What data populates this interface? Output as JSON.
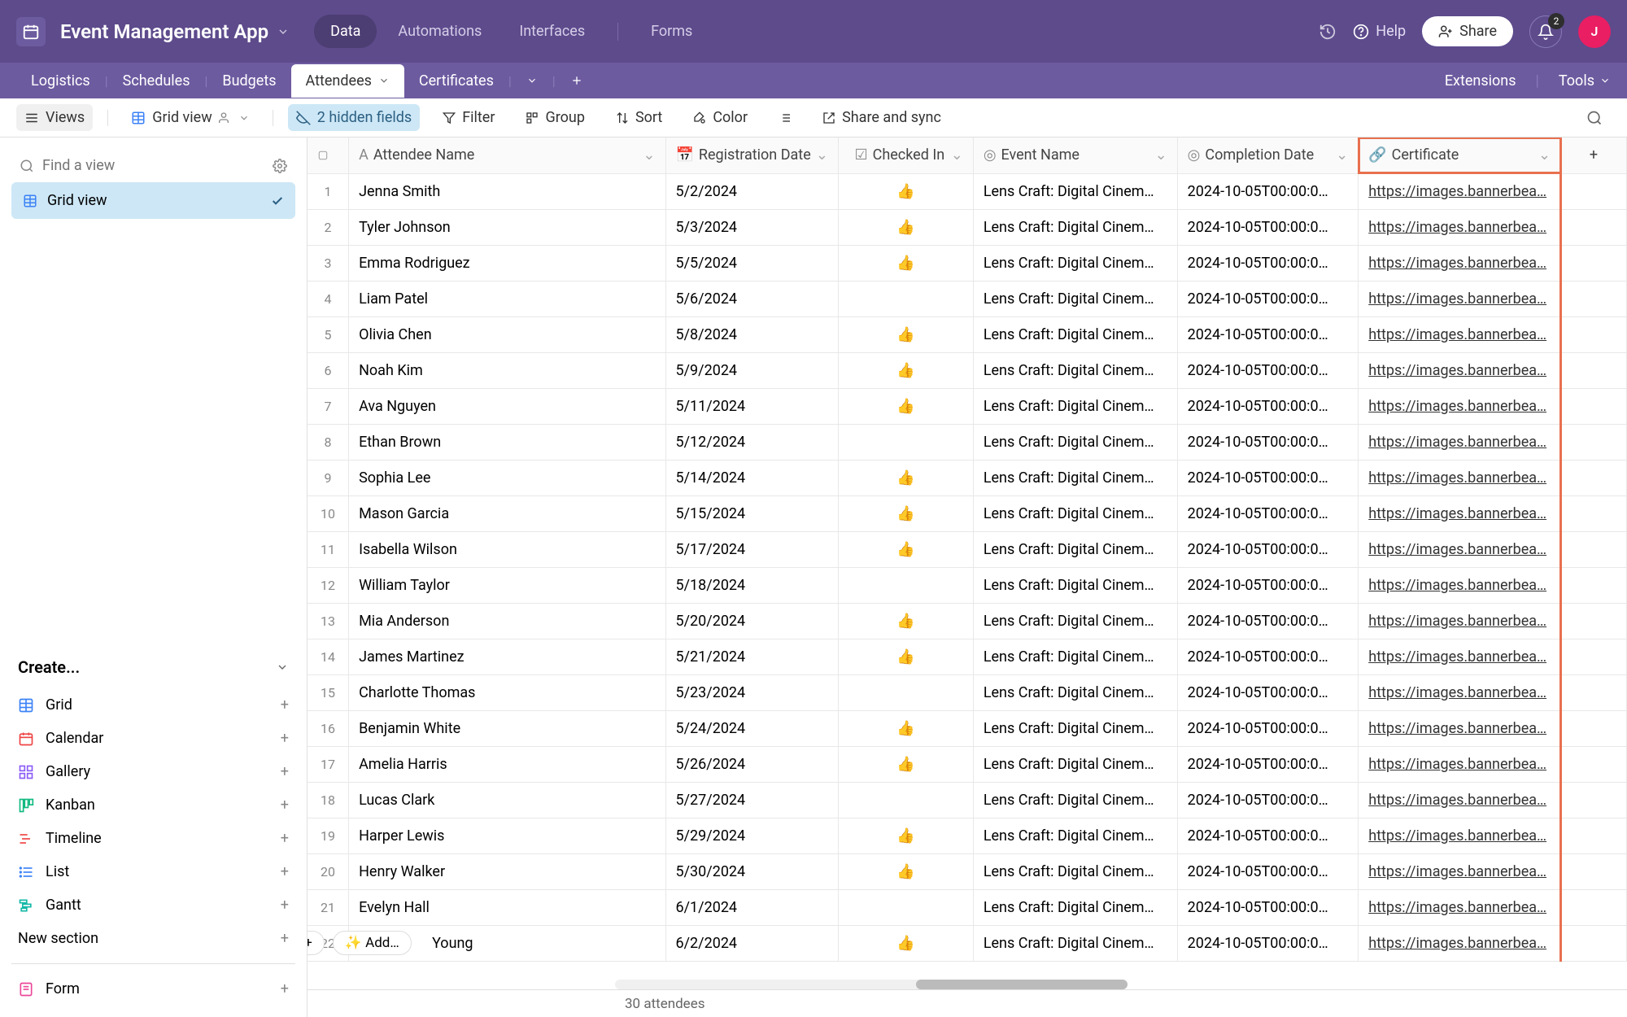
{
  "app": {
    "title": "Event Management App"
  },
  "top_tabs": [
    "Data",
    "Automations",
    "Interfaces",
    "Forms"
  ],
  "top_tabs_active": 0,
  "history_icon": "history",
  "help": "Help",
  "share": "Share",
  "notif_count": "2",
  "avatar_initial": "J",
  "table_tabs": [
    "Logistics",
    "Schedules",
    "Budgets",
    "Attendees",
    "Certificates"
  ],
  "table_tabs_active": 3,
  "extensions": "Extensions",
  "tools": "Tools",
  "toolbar": {
    "views": "Views",
    "grid_view": "Grid view",
    "hidden_fields": "2 hidden fields",
    "filter": "Filter",
    "group": "Group",
    "sort": "Sort",
    "color": "Color",
    "share_sync": "Share and sync"
  },
  "sidebar": {
    "find_placeholder": "Find a view",
    "grid_view": "Grid view",
    "create": "Create...",
    "items": [
      {
        "icon": "grid",
        "label": "Grid",
        "color": "#3b82f6"
      },
      {
        "icon": "calendar",
        "label": "Calendar",
        "color": "#ef4444"
      },
      {
        "icon": "gallery",
        "label": "Gallery",
        "color": "#8b5cf6"
      },
      {
        "icon": "kanban",
        "label": "Kanban",
        "color": "#10b981"
      },
      {
        "icon": "timeline",
        "label": "Timeline",
        "color": "#ef4444"
      },
      {
        "icon": "list",
        "label": "List",
        "color": "#3b82f6"
      },
      {
        "icon": "gantt",
        "label": "Gantt",
        "color": "#14b8a6"
      }
    ],
    "new_section": "New section",
    "form": "Form"
  },
  "columns": {
    "attendee": "Attendee Name",
    "registration": "Registration Date",
    "checked_in": "Checked In",
    "event": "Event Name",
    "completion": "Completion Date",
    "certificate": "Certificate"
  },
  "rows": [
    {
      "n": "1",
      "name": "Jenna Smith",
      "reg": "5/2/2024",
      "chk": true,
      "event": "Lens Craft: Digital Cinem…",
      "comp": "2024-10-05T00:00:0…",
      "cert": "https://images.bannerbea…"
    },
    {
      "n": "2",
      "name": "Tyler Johnson",
      "reg": "5/3/2024",
      "chk": true,
      "event": "Lens Craft: Digital Cinem…",
      "comp": "2024-10-05T00:00:0…",
      "cert": "https://images.bannerbea…"
    },
    {
      "n": "3",
      "name": "Emma Rodriguez",
      "reg": "5/5/2024",
      "chk": true,
      "event": "Lens Craft: Digital Cinem…",
      "comp": "2024-10-05T00:00:0…",
      "cert": "https://images.bannerbea…"
    },
    {
      "n": "4",
      "name": "Liam Patel",
      "reg": "5/6/2024",
      "chk": false,
      "event": "Lens Craft: Digital Cinem…",
      "comp": "2024-10-05T00:00:0…",
      "cert": "https://images.bannerbea…"
    },
    {
      "n": "5",
      "name": "Olivia Chen",
      "reg": "5/8/2024",
      "chk": true,
      "event": "Lens Craft: Digital Cinem…",
      "comp": "2024-10-05T00:00:0…",
      "cert": "https://images.bannerbea…"
    },
    {
      "n": "6",
      "name": "Noah Kim",
      "reg": "5/9/2024",
      "chk": true,
      "event": "Lens Craft: Digital Cinem…",
      "comp": "2024-10-05T00:00:0…",
      "cert": "https://images.bannerbea…"
    },
    {
      "n": "7",
      "name": "Ava Nguyen",
      "reg": "5/11/2024",
      "chk": true,
      "event": "Lens Craft: Digital Cinem…",
      "comp": "2024-10-05T00:00:0…",
      "cert": "https://images.bannerbea…"
    },
    {
      "n": "8",
      "name": "Ethan Brown",
      "reg": "5/12/2024",
      "chk": false,
      "event": "Lens Craft: Digital Cinem…",
      "comp": "2024-10-05T00:00:0…",
      "cert": "https://images.bannerbea…"
    },
    {
      "n": "9",
      "name": "Sophia Lee",
      "reg": "5/14/2024",
      "chk": true,
      "event": "Lens Craft: Digital Cinem…",
      "comp": "2024-10-05T00:00:0…",
      "cert": "https://images.bannerbea…"
    },
    {
      "n": "10",
      "name": "Mason Garcia",
      "reg": "5/15/2024",
      "chk": true,
      "event": "Lens Craft: Digital Cinem…",
      "comp": "2024-10-05T00:00:0…",
      "cert": "https://images.bannerbea…"
    },
    {
      "n": "11",
      "name": "Isabella Wilson",
      "reg": "5/17/2024",
      "chk": true,
      "event": "Lens Craft: Digital Cinem…",
      "comp": "2024-10-05T00:00:0…",
      "cert": "https://images.bannerbea…"
    },
    {
      "n": "12",
      "name": "William Taylor",
      "reg": "5/18/2024",
      "chk": false,
      "event": "Lens Craft: Digital Cinem…",
      "comp": "2024-10-05T00:00:0…",
      "cert": "https://images.bannerbea…"
    },
    {
      "n": "13",
      "name": "Mia Anderson",
      "reg": "5/20/2024",
      "chk": true,
      "event": "Lens Craft: Digital Cinem…",
      "comp": "2024-10-05T00:00:0…",
      "cert": "https://images.bannerbea…"
    },
    {
      "n": "14",
      "name": "James Martinez",
      "reg": "5/21/2024",
      "chk": true,
      "event": "Lens Craft: Digital Cinem…",
      "comp": "2024-10-05T00:00:0…",
      "cert": "https://images.bannerbea…"
    },
    {
      "n": "15",
      "name": "Charlotte Thomas",
      "reg": "5/23/2024",
      "chk": false,
      "event": "Lens Craft: Digital Cinem…",
      "comp": "2024-10-05T00:00:0…",
      "cert": "https://images.bannerbea…"
    },
    {
      "n": "16",
      "name": "Benjamin White",
      "reg": "5/24/2024",
      "chk": true,
      "event": "Lens Craft: Digital Cinem…",
      "comp": "2024-10-05T00:00:0…",
      "cert": "https://images.bannerbea…"
    },
    {
      "n": "17",
      "name": "Amelia Harris",
      "reg": "5/26/2024",
      "chk": true,
      "event": "Lens Craft: Digital Cinem…",
      "comp": "2024-10-05T00:00:0…",
      "cert": "https://images.bannerbea…"
    },
    {
      "n": "18",
      "name": "Lucas Clark",
      "reg": "5/27/2024",
      "chk": false,
      "event": "Lens Craft: Digital Cinem…",
      "comp": "2024-10-05T00:00:0…",
      "cert": "https://images.bannerbea…"
    },
    {
      "n": "19",
      "name": "Harper Lewis",
      "reg": "5/29/2024",
      "chk": true,
      "event": "Lens Craft: Digital Cinem…",
      "comp": "2024-10-05T00:00:0…",
      "cert": "https://images.bannerbea…"
    },
    {
      "n": "20",
      "name": "Henry Walker",
      "reg": "5/30/2024",
      "chk": true,
      "event": "Lens Craft: Digital Cinem…",
      "comp": "2024-10-05T00:00:0…",
      "cert": "https://images.bannerbea…"
    },
    {
      "n": "21",
      "name": "Evelyn Hall",
      "reg": "6/1/2024",
      "chk": false,
      "event": "Lens Craft: Digital Cinem…",
      "comp": "2024-10-05T00:00:0…",
      "cert": "https://images.bannerbea…"
    },
    {
      "n": "22",
      "name": "Young",
      "reg": "6/2/2024",
      "chk": true,
      "event": "Lens Craft: Digital Cinem…",
      "comp": "2024-10-05T00:00:0…",
      "cert": "https://images.bannerbea…"
    }
  ],
  "add_label": "Add…",
  "footer_count": "30 attendees"
}
